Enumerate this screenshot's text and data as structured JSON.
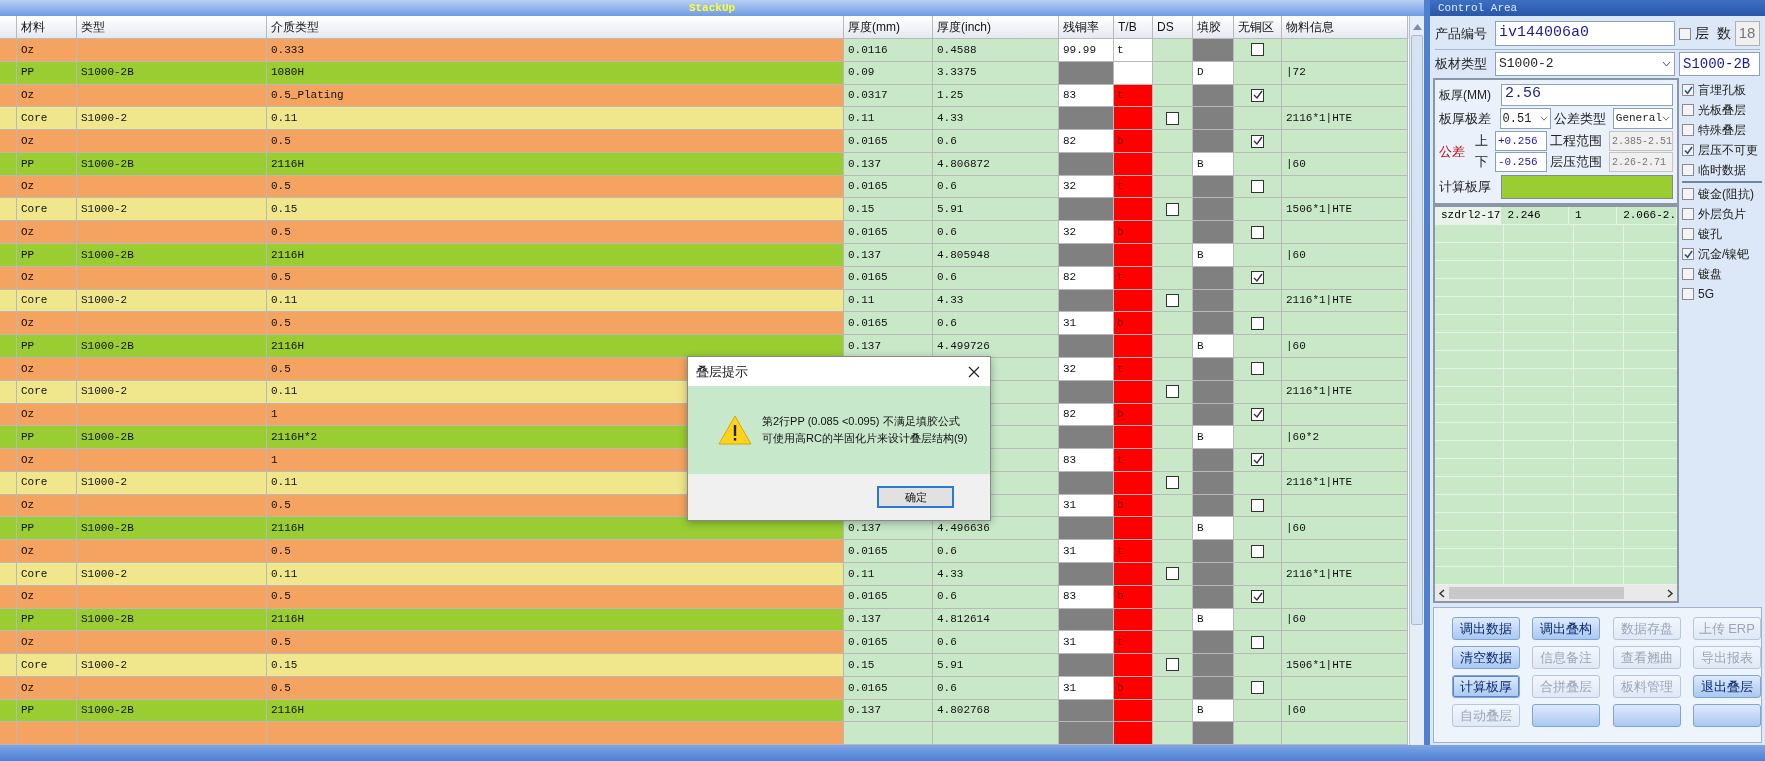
{
  "title": "StackUp",
  "columns": [
    "材料",
    "类型",
    "介质类型",
    "厚度(mm)",
    "厚度(inch)",
    "残铜率",
    "T/B",
    "DS",
    "填胶",
    "无铜区",
    "物料信息"
  ],
  "rows": [
    {
      "color": "#f4a460",
      "material": "Oz",
      "dielectric": "0.333",
      "mm": "0.0116",
      "inch": "0.4588",
      "copper": "99.99",
      "tb": "t",
      "tb_alert": false,
      "no_copper": false
    },
    {
      "color": "#9acd32",
      "material": "PP",
      "type": "S1000-2B",
      "dielectric": "1080H",
      "mm": "0.09",
      "inch": "3.3375",
      "tb_alert": false,
      "fill": "D",
      "info": "|72"
    },
    {
      "color": "#f4a460",
      "material": "Oz",
      "dielectric": "0.5_Plating",
      "mm": "0.0317",
      "inch": "1.25",
      "copper": "83",
      "tb": "t",
      "tb_alert": true,
      "no_copper": true
    },
    {
      "color": "#f0e68c",
      "material": "Core",
      "type": "S1000-2",
      "dielectric": "0.11",
      "mm": "0.11",
      "inch": "4.33",
      "tb_alert": true,
      "ds_checked": false,
      "info": "2116*1|HTE"
    },
    {
      "color": "#f4a460",
      "material": "Oz",
      "dielectric": "0.5",
      "mm": "0.0165",
      "inch": "0.6",
      "copper": "82",
      "tb": "b",
      "tb_alert": true,
      "no_copper": true
    },
    {
      "color": "#9acd32",
      "material": "PP",
      "type": "S1000-2B",
      "dielectric": "2116H",
      "mm": "0.137",
      "inch": "4.806872",
      "tb_alert": true,
      "fill": "B",
      "info": "|60"
    },
    {
      "color": "#f4a460",
      "material": "Oz",
      "dielectric": "0.5",
      "mm": "0.0165",
      "inch": "0.6",
      "copper": "32",
      "tb": "t",
      "tb_alert": true,
      "no_copper": false
    },
    {
      "color": "#f0e68c",
      "material": "Core",
      "type": "S1000-2",
      "dielectric": "0.15",
      "mm": "0.15",
      "inch": "5.91",
      "tb_alert": true,
      "ds_checked": false,
      "info": "1506*1|HTE"
    },
    {
      "color": "#f4a460",
      "material": "Oz",
      "dielectric": "0.5",
      "mm": "0.0165",
      "inch": "0.6",
      "copper": "32",
      "tb": "b",
      "tb_alert": true,
      "no_copper": false
    },
    {
      "color": "#9acd32",
      "material": "PP",
      "type": "S1000-2B",
      "dielectric": "2116H",
      "mm": "0.137",
      "inch": "4.805948",
      "tb_alert": true,
      "fill": "B",
      "info": "|60"
    },
    {
      "color": "#f4a460",
      "material": "Oz",
      "dielectric": "0.5",
      "mm": "0.0165",
      "inch": "0.6",
      "copper": "82",
      "tb": "t",
      "tb_alert": true,
      "no_copper": true
    },
    {
      "color": "#f0e68c",
      "material": "Core",
      "type": "S1000-2",
      "dielectric": "0.11",
      "mm": "0.11",
      "inch": "4.33",
      "tb_alert": true,
      "ds_checked": false,
      "info": "2116*1|HTE"
    },
    {
      "color": "#f4a460",
      "material": "Oz",
      "dielectric": "0.5",
      "mm": "0.0165",
      "inch": "0.6",
      "copper": "31",
      "tb": "b",
      "tb_alert": true,
      "no_copper": false
    },
    {
      "color": "#9acd32",
      "material": "PP",
      "type": "S1000-2B",
      "dielectric": "2116H",
      "mm": "0.137",
      "inch": "4.499726",
      "tb_alert": true,
      "fill": "B",
      "info": "|60"
    },
    {
      "color": "#f4a460",
      "material": "Oz",
      "dielectric": "0.5",
      "copper": "32",
      "tb": "t",
      "tb_alert": true,
      "no_copper": false
    },
    {
      "color": "#f0e68c",
      "material": "Core",
      "type": "S1000-2",
      "dielectric": "0.11",
      "tb_alert": true,
      "ds_checked": false,
      "info": "2116*1|HTE"
    },
    {
      "color": "#f4a460",
      "material": "Oz",
      "dielectric": "1",
      "copper": "82",
      "tb": "b",
      "tb_alert": true,
      "no_copper": true
    },
    {
      "color": "#9acd32",
      "material": "PP",
      "type": "S1000-2B",
      "dielectric": "2116H*2",
      "tb_alert": true,
      "fill": "B",
      "info": "|60*2"
    },
    {
      "color": "#f4a460",
      "material": "Oz",
      "dielectric": "1",
      "copper": "83",
      "tb": "t",
      "tb_alert": true,
      "no_copper": true
    },
    {
      "color": "#f0e68c",
      "material": "Core",
      "type": "S1000-2",
      "dielectric": "0.11",
      "tb_alert": true,
      "ds_checked": false,
      "info": "2116*1|HTE"
    },
    {
      "color": "#f4a460",
      "material": "Oz",
      "dielectric": "0.5",
      "copper": "31",
      "tb": "b",
      "tb_alert": true,
      "no_copper": false
    },
    {
      "color": "#9acd32",
      "material": "PP",
      "type": "S1000-2B",
      "dielectric": "2116H",
      "mm": "0.137",
      "inch": "4.496636",
      "tb_alert": true,
      "fill": "B",
      "info": "|60"
    },
    {
      "color": "#f4a460",
      "material": "Oz",
      "dielectric": "0.5",
      "mm": "0.0165",
      "inch": "0.6",
      "copper": "31",
      "tb": "t",
      "tb_alert": true,
      "no_copper": false
    },
    {
      "color": "#f0e68c",
      "material": "Core",
      "type": "S1000-2",
      "dielectric": "0.11",
      "mm": "0.11",
      "inch": "4.33",
      "tb_alert": true,
      "ds_checked": false,
      "info": "2116*1|HTE"
    },
    {
      "color": "#f4a460",
      "material": "Oz",
      "dielectric": "0.5",
      "mm": "0.0165",
      "inch": "0.6",
      "copper": "83",
      "tb": "b",
      "tb_alert": true,
      "no_copper": true
    },
    {
      "color": "#9acd32",
      "material": "PP",
      "type": "S1000-2B",
      "dielectric": "2116H",
      "mm": "0.137",
      "inch": "4.812614",
      "tb_alert": true,
      "fill": "B",
      "info": "|60"
    },
    {
      "color": "#f4a460",
      "material": "Oz",
      "dielectric": "0.5",
      "mm": "0.0165",
      "inch": "0.6",
      "copper": "31",
      "tb": "t",
      "tb_alert": true,
      "no_copper": false
    },
    {
      "color": "#f0e68c",
      "material": "Core",
      "type": "S1000-2",
      "dielectric": "0.15",
      "mm": "0.15",
      "inch": "5.91",
      "tb_alert": true,
      "ds_checked": false,
      "info": "1506*1|HTE"
    },
    {
      "color": "#f4a460",
      "material": "Oz",
      "dielectric": "0.5",
      "mm": "0.0165",
      "inch": "0.6",
      "copper": "31",
      "tb": "b",
      "tb_alert": true,
      "no_copper": false
    },
    {
      "color": "#9acd32",
      "material": "PP",
      "type": "S1000-2B",
      "dielectric": "2116H",
      "mm": "0.137",
      "inch": "4.802768",
      "tb_alert": true,
      "fill": "B",
      "info": "|60"
    },
    {
      "color": "#f4a460",
      "tb_alert": true
    }
  ],
  "dialog": {
    "title": "叠层提示",
    "lines": [
      "第2行PP (0.085 <0.095) 不满足填胶公式",
      "可使用高RC的半固化片来设计叠层结构(9)"
    ],
    "button": "确定"
  },
  "control_area": {
    "title": "Control Area",
    "product_label": "产品编号",
    "product_value": "iv144006a0",
    "layers_checked": false,
    "layers_label": "层  数",
    "layers_value": "18",
    "board_label": "板材类型",
    "board_value": "S1000-2",
    "board_value2": "S1000-2B",
    "thickness_label": "板厚(MM)",
    "thickness_value": "2.56",
    "range_label": "板厚极差",
    "range_value": "0.51",
    "tol_type_label": "公差类型",
    "tol_type_value": "General",
    "tol_label": "公差",
    "upper_label": "上",
    "upper_value": "+0.256",
    "eng_label": "工程范围",
    "eng_value": "2.385-2.51",
    "lower_label": "下",
    "lower_value": "-0.256",
    "lam_label": "层压范围",
    "lam_value": "2.26-2.71",
    "calc_label": "计算板厚",
    "grid_rows": [
      [
        "szdrl2-17",
        "2.246",
        "1",
        "2.066-2."
      ]
    ],
    "options": [
      {
        "label": "盲埋孔板",
        "checked": true
      },
      {
        "label": "光板叠层",
        "checked": false
      },
      {
        "label": "特殊叠层",
        "checked": false
      },
      {
        "label": "层压不可更",
        "checked": true
      },
      {
        "label": "临时数据",
        "checked": false
      }
    ],
    "options2": [
      {
        "label": "镀金(阻抗)",
        "checked": false
      },
      {
        "label": "外层负片",
        "checked": false
      },
      {
        "label": "镀孔",
        "checked": false
      },
      {
        "label": "沉金/镍钯",
        "checked": true
      },
      {
        "label": "镀盘",
        "checked": false
      },
      {
        "label": "5G",
        "checked": false
      }
    ],
    "buttons": [
      {
        "label": "调出数据",
        "disabled": false,
        "focused": false
      },
      {
        "label": "调出叠构",
        "disabled": false,
        "focused": false
      },
      {
        "label": "数据存盘",
        "disabled": true,
        "focused": false
      },
      {
        "label": "上传 ERP",
        "disabled": true,
        "focused": false
      },
      {
        "label": "清空数据",
        "disabled": false,
        "focused": false
      },
      {
        "label": "信息备注",
        "disabled": true,
        "focused": false
      },
      {
        "label": "查看翘曲",
        "disabled": true,
        "focused": false
      },
      {
        "label": "导出报表",
        "disabled": true,
        "focused": false
      },
      {
        "label": "计算板厚",
        "disabled": false,
        "focused": true
      },
      {
        "label": "合拼叠层",
        "disabled": true,
        "focused": false
      },
      {
        "label": "板料管理",
        "disabled": true,
        "focused": false
      },
      {
        "label": "退出叠层",
        "disabled": false,
        "focused": false
      },
      {
        "label": "自动叠层",
        "disabled": true,
        "focused": false
      },
      {
        "disabled": false,
        "focused": false
      },
      {
        "disabled": false,
        "focused": false
      },
      {
        "disabled": false,
        "focused": false
      }
    ]
  }
}
